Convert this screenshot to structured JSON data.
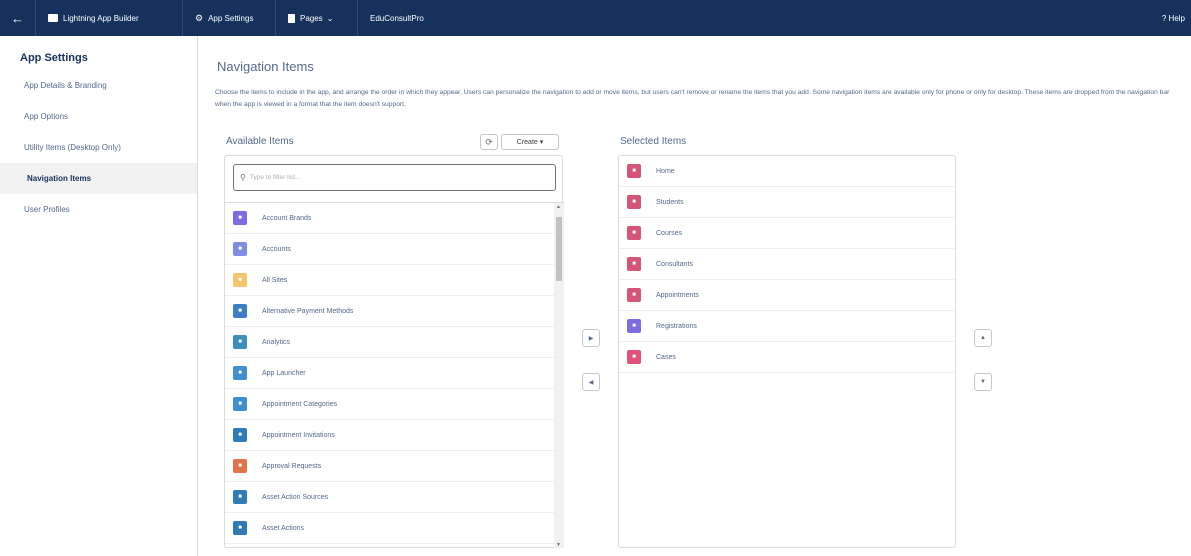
{
  "topbar": {
    "back_icon": "arrow-left-icon",
    "builder_label": "Lightning App Builder",
    "settings_label": "App Settings",
    "pages_label": "Pages",
    "app_name": "EduConsultPro",
    "help_label": "? Help"
  },
  "sidebar": {
    "title": "App Settings",
    "items": [
      {
        "label": "App Details & Branding",
        "active": false
      },
      {
        "label": "App Options",
        "active": false
      },
      {
        "label": "Utility Items (Desktop Only)",
        "active": false
      },
      {
        "label": "Navigation Items",
        "active": true
      },
      {
        "label": "User Profiles",
        "active": false
      }
    ]
  },
  "main": {
    "title": "Navigation Items",
    "description": "Choose the items to include in the app, and arrange the order in which they appear. Users can personalize the navigation to add or move items, but users can't remove or rename the items that you add. Some navigation items are available only for phone or only for desktop. These items are dropped from the navigation bar when the app is viewed in a format that the item doesn't support."
  },
  "available": {
    "label": "Available Items",
    "create_label": "Create ▾",
    "search_placeholder": "Type to filter list...",
    "items": [
      {
        "label": "Account Brands",
        "color": "#7f6de0",
        "icon": "brand-icon"
      },
      {
        "label": "Accounts",
        "color": "#7f8de1",
        "icon": "account-icon"
      },
      {
        "label": "All Sites",
        "color": "#f2c46b",
        "icon": "sites-icon"
      },
      {
        "label": "Alternative Payment Methods",
        "color": "#3e7fc3",
        "icon": "payment-icon"
      },
      {
        "label": "Analytics",
        "color": "#3d8eb8",
        "icon": "analytics-icon"
      },
      {
        "label": "App Launcher",
        "color": "#3e8fd0",
        "icon": "grid-icon"
      },
      {
        "label": "Appointment Categories",
        "color": "#3e8fd0",
        "icon": "appointment-category-icon"
      },
      {
        "label": "Appointment Invitations",
        "color": "#2f7bb5",
        "icon": "invitation-icon"
      },
      {
        "label": "Approval Requests",
        "color": "#e0744a",
        "icon": "approval-icon"
      },
      {
        "label": "Asset Action Sources",
        "color": "#2f7bb5",
        "icon": "asset-icon"
      },
      {
        "label": "Asset Actions",
        "color": "#2f7bb5",
        "icon": "asset-action-icon"
      }
    ]
  },
  "selected": {
    "label": "Selected Items",
    "items": [
      {
        "label": "Home",
        "color": "#d5547a",
        "icon": "home-icon"
      },
      {
        "label": "Students",
        "color": "#d5547a",
        "icon": "custom-object-icon"
      },
      {
        "label": "Courses",
        "color": "#d5547a",
        "icon": "custom-object-icon"
      },
      {
        "label": "Consultants",
        "color": "#d5547a",
        "icon": "custom-object-icon"
      },
      {
        "label": "Appointments",
        "color": "#d5547a",
        "icon": "custom-object-icon"
      },
      {
        "label": "Registrations",
        "color": "#7f6de0",
        "icon": "star-icon"
      },
      {
        "label": "Cases",
        "color": "#e2507b",
        "icon": "case-icon"
      }
    ]
  }
}
